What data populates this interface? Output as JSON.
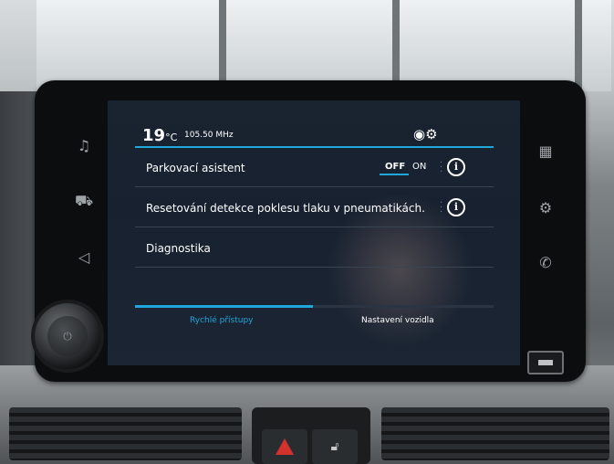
{
  "status": {
    "temperature": "19",
    "temperature_unit": "°C",
    "frequency": "105.50 MHz",
    "status_icons": "◉⚙"
  },
  "menu": {
    "items": [
      {
        "label": "Parkovací asistent",
        "toggle_off": "OFF",
        "toggle_on": "ON",
        "toggle_state": "OFF",
        "info": "i"
      },
      {
        "label": "Resetování detekce poklesu tlaku v pneumatikách.",
        "info": "i"
      },
      {
        "label": "Diagnostika"
      }
    ]
  },
  "tabs": {
    "quick": "Rychlé přístupy",
    "vehicle": "Nastavení vozidla",
    "active": "quick"
  },
  "side_buttons": {
    "left": [
      "music-icon",
      "car-icon",
      "navigation-icon"
    ],
    "right": [
      "apps-icon",
      "settings-icon",
      "phone-icon"
    ]
  },
  "colors": {
    "accent": "#1fa7d9",
    "screen_bg": "#172130",
    "hazard": "#d3322c"
  }
}
